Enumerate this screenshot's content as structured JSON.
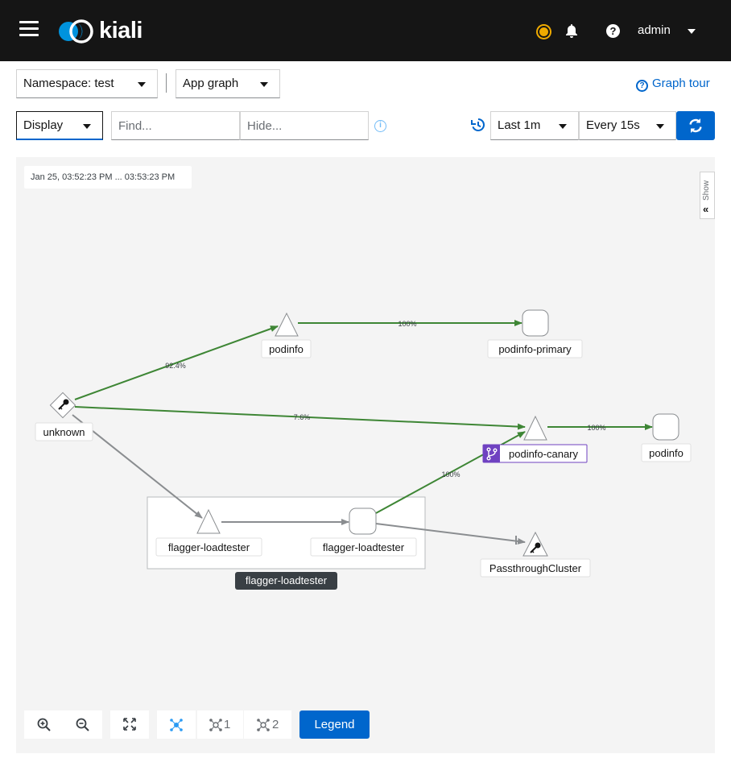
{
  "masthead": {
    "logo_text": "kiali",
    "user": "admin"
  },
  "toolbar": {
    "namespace_select": "Namespace: test",
    "graph_type_select": "App graph",
    "graph_tour": "Graph tour",
    "display_select": "Display",
    "find_placeholder": "Find...",
    "hide_placeholder": "Hide...",
    "duration_select": "Last 1m",
    "refresh_interval_select": "Every 15s"
  },
  "graph": {
    "timestamp": "Jan 25, 03:52:23 PM ... 03:53:23 PM",
    "show_panel": "Show",
    "nodes": {
      "unknown": "unknown",
      "podinfo_app": "podinfo",
      "podinfo_primary": "podinfo-primary",
      "podinfo_canary": "podinfo-canary",
      "podinfo_service": "podinfo",
      "flagger_app": "flagger-loadtester",
      "flagger_workload": "flagger-loadtester",
      "flagger_box": "flagger-loadtester",
      "passthrough": "PassthroughCluster"
    },
    "edges": {
      "unknown_podinfo": "92.4%",
      "podinfo_primary": "100%",
      "unknown_canary": "7.6%",
      "canary_service": "100%",
      "flagger_canary": "100%"
    },
    "colors": {
      "healthy_edge": "#3e8635",
      "tcp_edge": "#8a8d90",
      "virtual_service_badge": "#6f42c1",
      "box_label_bg": "#393f44"
    }
  },
  "bottom_toolbar": {
    "hide_level_1": "1",
    "hide_level_2": "2",
    "legend": "Legend"
  }
}
